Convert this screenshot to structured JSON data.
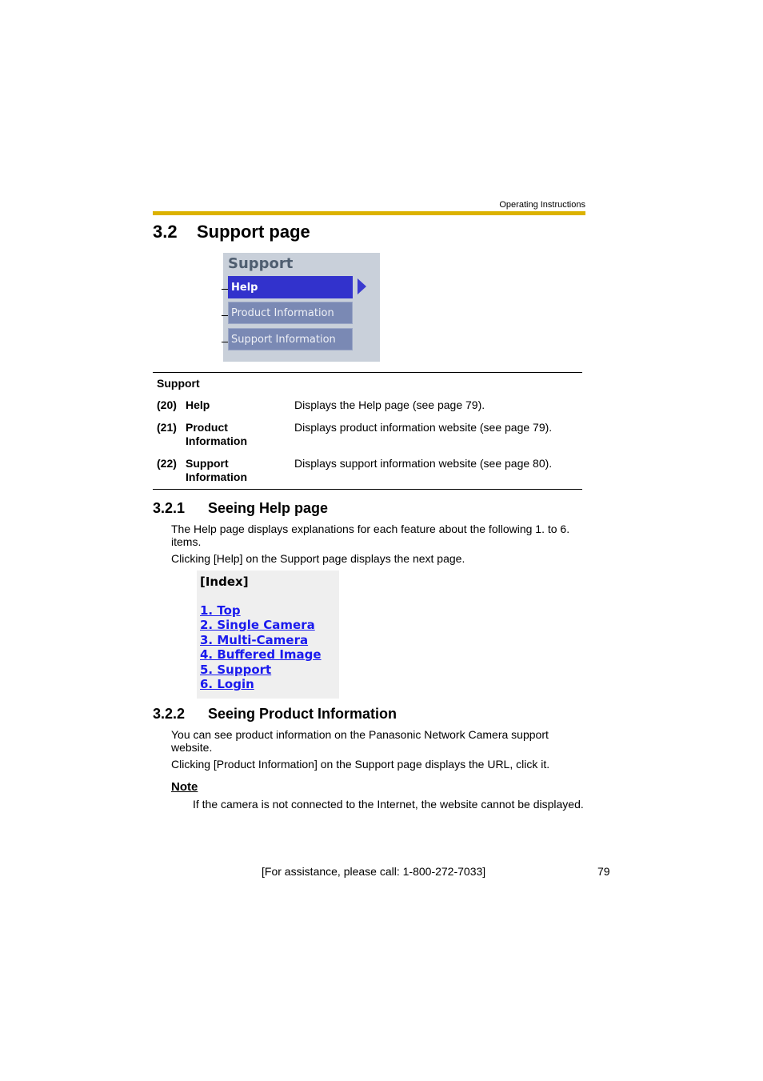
{
  "header": {
    "label": "Operating Instructions",
    "rule_color": "#dcb200"
  },
  "section": {
    "number": "3.2",
    "title": "Support page"
  },
  "support_menu": {
    "title": "Support",
    "items": [
      {
        "label": "Help",
        "active": true
      },
      {
        "label": "Product Information",
        "active": false
      },
      {
        "label": "Support Information",
        "active": false
      }
    ],
    "active_color": "#3232cc",
    "inactive_color": "#7a89b4"
  },
  "table": {
    "heading": "Support",
    "rows": [
      {
        "num": "(20)",
        "name": "Help",
        "desc": "Displays the Help page (see page 79)."
      },
      {
        "num": "(21)",
        "name": "Product Information",
        "desc": "Displays product information website (see page 79)."
      },
      {
        "num": "(22)",
        "name": "Support Information",
        "desc": "Displays support information website (see page 80)."
      }
    ]
  },
  "sub1": {
    "number": "3.2.1",
    "title": "Seeing Help page",
    "para1": "The Help page displays explanations for each feature about the following 1. to 6. items.",
    "para2": "Clicking [Help] on the Support page displays the next page."
  },
  "help_index": {
    "title": "[Index]",
    "links": [
      "1. Top",
      "2. Single Camera",
      "3. Multi-Camera",
      "4. Buffered Image",
      "5. Support",
      "6. Login"
    ]
  },
  "sub2": {
    "number": "3.2.2",
    "title": "Seeing Product Information",
    "para1": "You can see product information on the Panasonic Network Camera support website.",
    "para2": "Clicking [Product Information] on the Support page displays the URL, click it."
  },
  "note": {
    "title": "Note",
    "body": "If the camera is not connected to the Internet, the website cannot be displayed."
  },
  "footer": {
    "assistance": "[For assistance, please call: 1-800-272-7033]",
    "page_number": "79"
  }
}
